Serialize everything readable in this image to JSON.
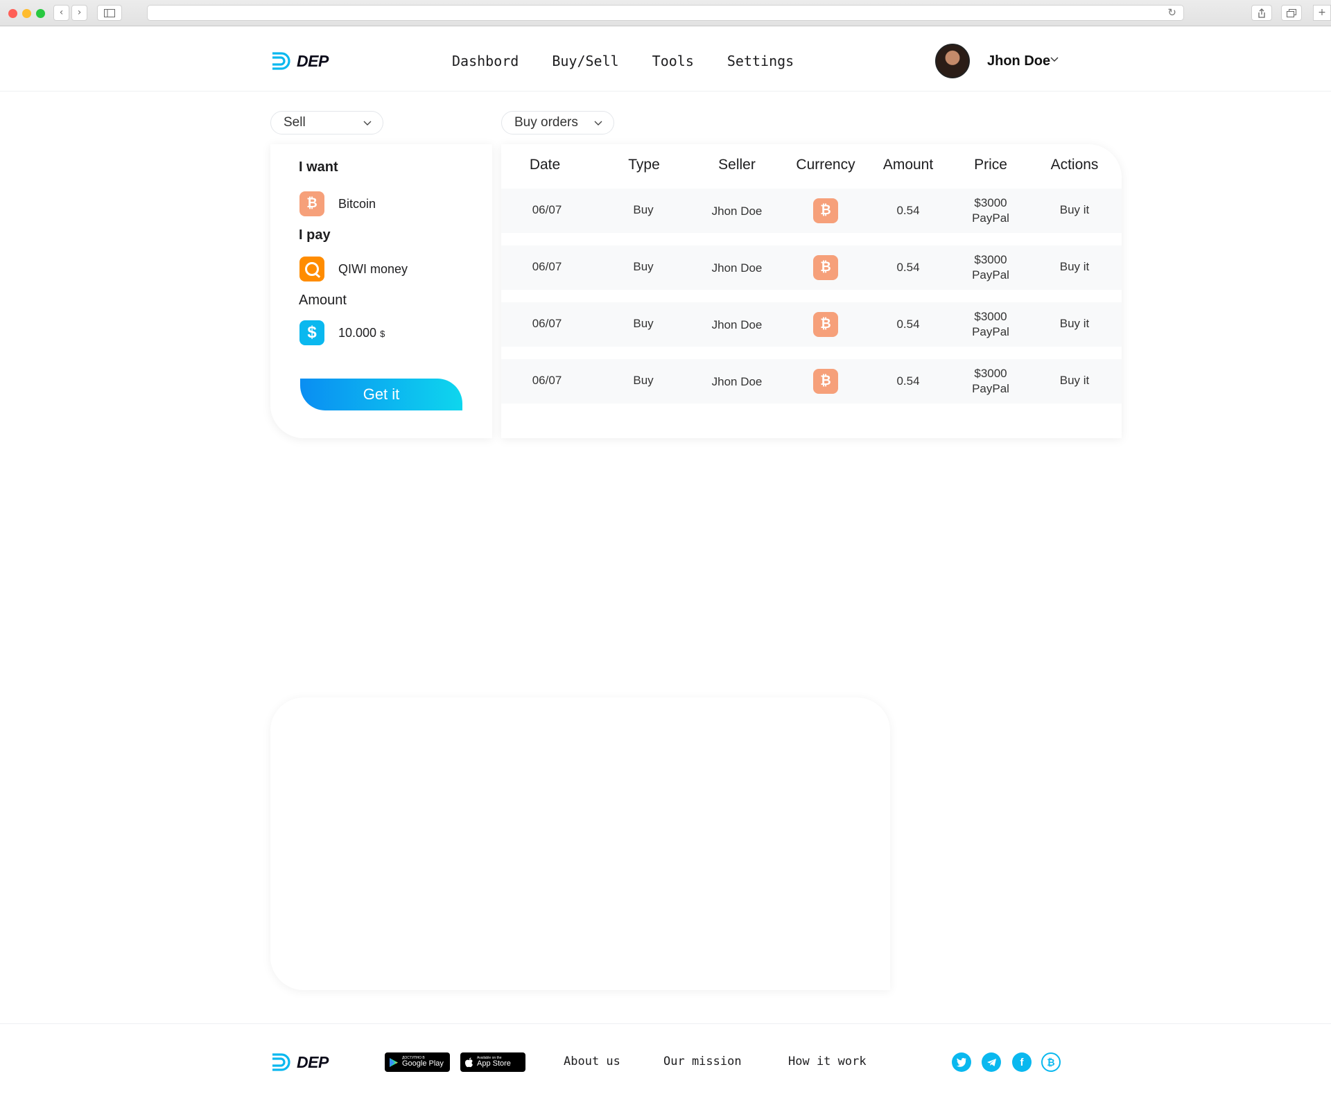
{
  "browser": {
    "back_glyph": "‹",
    "forward_glyph": "›",
    "reload_glyph": "↻"
  },
  "brand": {
    "name": "DEP",
    "accent": "#0ab8ef"
  },
  "nav": {
    "items": [
      {
        "label": "Dashbord"
      },
      {
        "label": "Buy/Sell"
      },
      {
        "label": "Tools"
      },
      {
        "label": "Settings"
      }
    ]
  },
  "user": {
    "name": "Jhon Doe"
  },
  "filters": {
    "mode": "Sell",
    "orders": "Buy orders"
  },
  "form": {
    "want_label": "I want",
    "want_value": "Bitcoin",
    "pay_label": "I pay",
    "pay_value": "QIWI money",
    "amount_label": "Amount",
    "amount_value": "10.000",
    "amount_unit": "$",
    "submit_label": "Get it",
    "icons": [
      "bitcoin-icon",
      "qiwi-icon",
      "dollar-icon"
    ]
  },
  "orders": {
    "columns": [
      "Date",
      "Type",
      "Seller",
      "Currency",
      "Amount",
      "Price",
      "Actions"
    ],
    "rows": [
      {
        "date": "06/07",
        "type": "Buy",
        "seller": "Jhon Doe",
        "currency": "bitcoin-icon",
        "amount": "0.54",
        "price": "$3000",
        "method": "PayPal",
        "action": "Buy it"
      },
      {
        "date": "06/07",
        "type": "Buy",
        "seller": "Jhon Doe",
        "currency": "bitcoin-icon",
        "amount": "0.54",
        "price": "$3000",
        "method": "PayPal",
        "action": "Buy it"
      },
      {
        "date": "06/07",
        "type": "Buy",
        "seller": "Jhon Doe",
        "currency": "bitcoin-icon",
        "amount": "0.54",
        "price": "$3000",
        "method": "PayPal",
        "action": "Buy it"
      },
      {
        "date": "06/07",
        "type": "Buy",
        "seller": "Jhon Doe",
        "currency": "bitcoin-icon",
        "amount": "0.54",
        "price": "$3000",
        "method": "PayPal",
        "action": "Buy it"
      }
    ],
    "colors": {
      "bitcoin": "#f6a07a",
      "row_bg": "#f8f9fa"
    }
  },
  "footer": {
    "google_play": {
      "small": "ДОСТУПНО В",
      "big": "Google Play"
    },
    "app_store": {
      "small": "Available on the",
      "big": "App Store"
    },
    "links": [
      {
        "label": "About us"
      },
      {
        "label": "Our mission"
      },
      {
        "label": "How it work"
      }
    ],
    "social": [
      "twitter-icon",
      "telegram-icon",
      "facebook-icon",
      "bitcoin-icon"
    ]
  }
}
